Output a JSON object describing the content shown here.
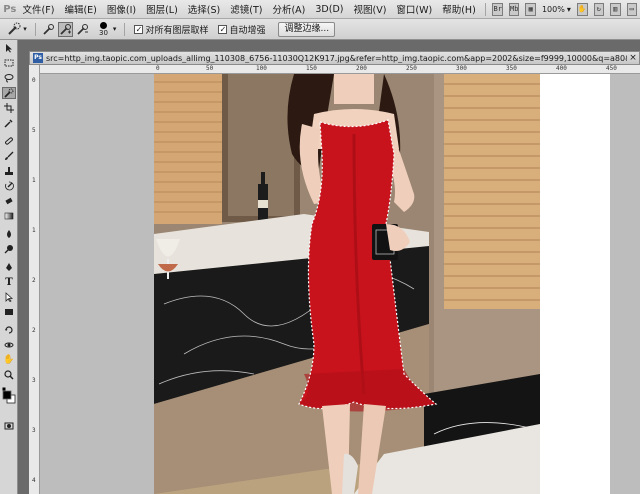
{
  "app": {
    "logo": "Ps",
    "menu": [
      "文件(F)",
      "编辑(E)",
      "图像(I)",
      "图层(L)",
      "选择(S)",
      "滤镜(T)",
      "分析(A)",
      "3D(D)",
      "视图(V)",
      "窗口(W)",
      "帮助(H)"
    ],
    "zoom_level": "100%",
    "icons": [
      "bridge-icon",
      "mini-bridge-icon",
      "view-extras-icon",
      "zoom-dropdown-icon",
      "hand-icon",
      "rotate-icon",
      "arrange-icon",
      "screen-mode-icon"
    ]
  },
  "options_bar": {
    "tool_icon": "quick-selection-icon",
    "modes": [
      "new-selection-icon",
      "add-to-selection-icon",
      "subtract-selection-icon"
    ],
    "active_mode": 1,
    "brush_size": "30",
    "sample_all_layers": {
      "checked": true,
      "label": "对所有图层取样"
    },
    "auto_enhance": {
      "checked": true,
      "label": "自动增强"
    },
    "refine_edge_label": "调整边缘..."
  },
  "tools": [
    "move-icon",
    "marquee-icon",
    "lasso-icon",
    "quick-selection-icon",
    "crop-icon",
    "eyedropper-icon",
    "healing-brush-icon",
    "brush-icon",
    "clone-stamp-icon",
    "history-brush-icon",
    "eraser-icon",
    "gradient-icon",
    "blur-icon",
    "dodge-icon",
    "pen-icon",
    "type-icon",
    "path-selection-icon",
    "shape-icon",
    "3d-rotate-icon",
    "3d-orbit-icon",
    "hand-icon",
    "zoom-icon",
    "color-swatches-icon",
    "quick-mask-icon"
  ],
  "active_tool": 3,
  "document": {
    "title": "src=http_img.taopic.com_uploads_allimg_110308_6756-11030Q12K917.jpg&refer=http_img.taopic.com&app=2002&size=f9999,10000&q=a80&n=0&g=0n&fmt=jpeg.jpg @ 100%(RGB/8)",
    "close_label": "×",
    "ruler_top_labels": [
      "0",
      "50",
      "100",
      "150",
      "200",
      "250",
      "300",
      "350",
      "400",
      "450"
    ],
    "ruler_left_labels": [
      "0",
      "5",
      "1",
      "1",
      "2",
      "2",
      "3",
      "3",
      "4"
    ]
  },
  "colors": {
    "dress": "#c8131d",
    "dress_shadow": "#8e0a12",
    "marble": "#141414",
    "wall": "#9e8a74",
    "blind": "#d9ad78",
    "floor": "#b89868",
    "skin": "#f1d2bf",
    "hair": "#2c1a12"
  }
}
